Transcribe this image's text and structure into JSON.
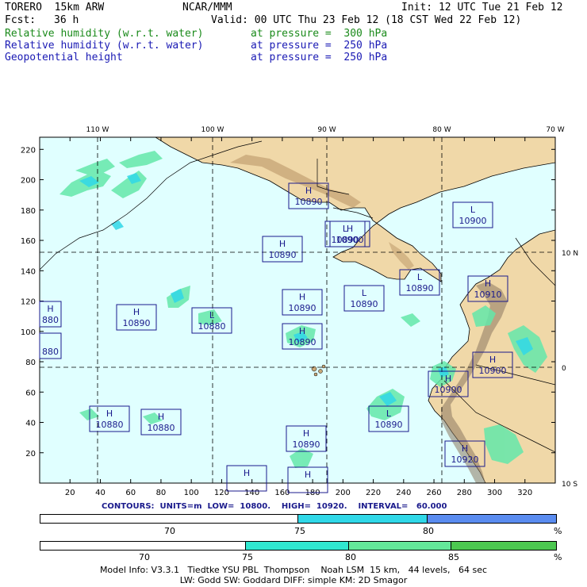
{
  "header": {
    "model": "TORERO  15km ARW",
    "org": "NCAR/MMM",
    "init": "Init: 12 UTC Tue 21 Feb 12",
    "fcst_label": "Fcst:",
    "fcst_value": "36 h",
    "valid": "Valid: 00 UTC Thu 23 Feb 12 (18 CST Wed 22 Feb 12)"
  },
  "fields": [
    {
      "name": "Relative humidity (w.r.t. water)",
      "level": "at pressure =  300 hPa",
      "color": "#1a8a1a"
    },
    {
      "name": "Relative humidity (w.r.t. water)",
      "level": "at pressure =  250 hPa",
      "color": "#1a1ab4"
    },
    {
      "name": "Geopotential height",
      "level": "at pressure =  250 hPa",
      "color": "#1a1ab4"
    }
  ],
  "map": {
    "lon_labels": [
      "110 W",
      "100 W",
      "90 W",
      "80 W",
      "70 W"
    ],
    "lat_labels": [
      "10 N",
      "0",
      "10 S"
    ],
    "x_ticks": [
      "20",
      "40",
      "60",
      "80",
      "100",
      "120",
      "140",
      "160",
      "180",
      "200",
      "220",
      "240",
      "260",
      "280",
      "300",
      "320"
    ],
    "y_ticks": [
      "220",
      "200",
      "180",
      "160",
      "140",
      "120",
      "100",
      "80",
      "60",
      "40",
      "20"
    ],
    "ocean_color": "#e0ffff",
    "land_color": "#f0d8a8",
    "highs_lows": [
      {
        "type": "H",
        "value": "10890"
      },
      {
        "type": "L",
        "value": "10890"
      },
      {
        "type": "H",
        "value": "10890"
      },
      {
        "type": "L",
        "value": "10900"
      },
      {
        "type": "H",
        "value": "10890"
      },
      {
        "type": "L",
        "value": "10890"
      },
      {
        "type": "H",
        "value": "10910"
      },
      {
        "type": "H",
        "value": "10890"
      },
      {
        "type": "L",
        "value": "10880"
      },
      {
        "type": "H",
        "value": "10890"
      },
      {
        "type": "H",
        "value": "10900"
      },
      {
        "type": "L",
        "value": "10890"
      },
      {
        "type": "H",
        "value": "10900"
      },
      {
        "type": "H",
        "value": "10880"
      },
      {
        "type": "H",
        "value": "10880"
      },
      {
        "type": "L",
        "value": "10890"
      },
      {
        "type": "H",
        "value": "10890"
      },
      {
        "type": "H",
        "value": "10920"
      },
      {
        "type": "H",
        "value": "880"
      },
      {
        "type": "",
        "value": "880"
      },
      {
        "type": "H",
        "value": "10900"
      },
      {
        "type": "H",
        "value": ""
      },
      {
        "type": "H",
        "value": ""
      }
    ]
  },
  "contours": "CONTOURS:  UNITS=m  LOW=  10800.    HIGH=  10920.    INTERVAL=   60.000",
  "legend_250": {
    "colors": [
      "#ffffff",
      "#30d8e8",
      "#5a8cf0"
    ],
    "labels": [
      "70",
      "75",
      "80",
      "%"
    ]
  },
  "legend_300": {
    "colors": [
      "#ffffff",
      "#30e8d0",
      "#64e89a",
      "#4cc850"
    ],
    "labels": [
      "70",
      "75",
      "80",
      "85",
      "%"
    ]
  },
  "footer": {
    "line1": "Model Info: V3.3.1   Tiedtke YSU PBL  Thompson    Noah LSM  15 km,   44 levels,   64 sec",
    "line2": "LW: Godd SW: Goddard DIFF: simple KM: 2D Smagor"
  }
}
